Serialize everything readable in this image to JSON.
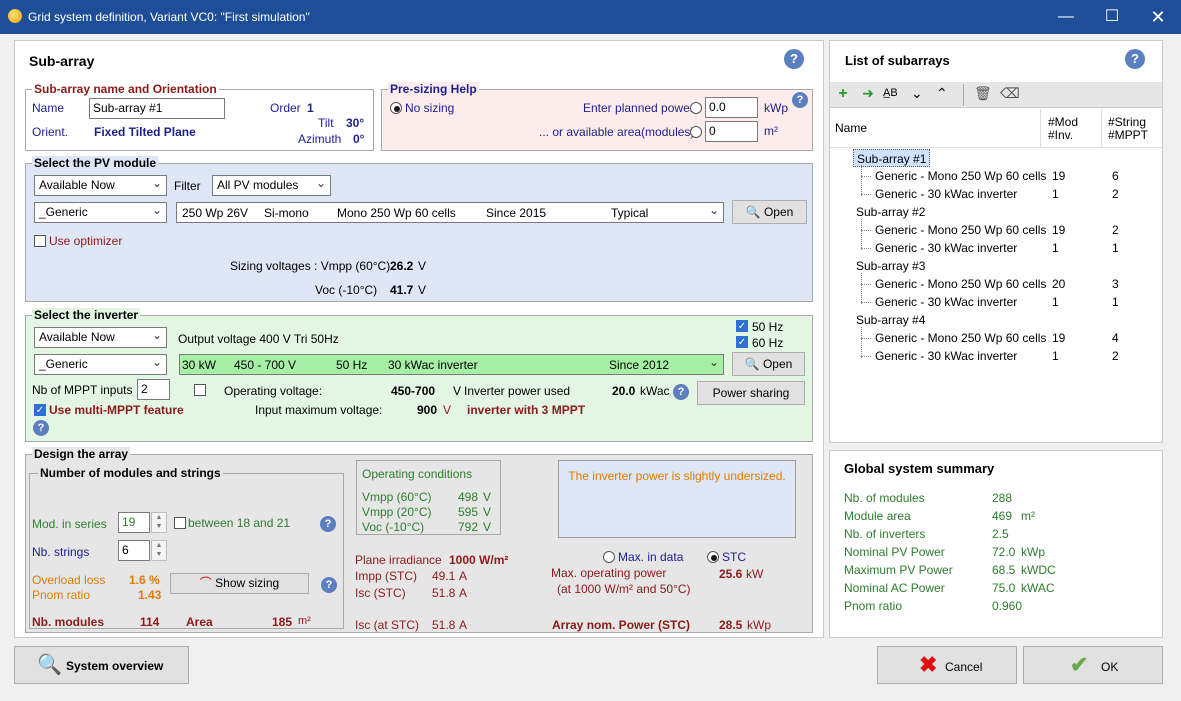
{
  "window": {
    "title": "Grid system definition, Variant VC0:   \"First simulation\""
  },
  "subarray_panel": {
    "title": "Sub-array",
    "name_orient": {
      "title": "Sub-array name and Orientation",
      "name_label": "Name",
      "name_value": "Sub-array #1",
      "order_label": "Order",
      "order_value": "1",
      "orient_label": "Orient.",
      "orient_value": "Fixed Tilted Plane",
      "tilt_label": "Tilt",
      "tilt_value": "30°",
      "azimuth_label": "Azimuth",
      "azimuth_value": "0°"
    },
    "presizing": {
      "title": "Pre-sizing Help",
      "no_sizing": "No sizing",
      "planned_power_label": "Enter planned power",
      "planned_power_value": "0.0",
      "planned_power_unit": "kWp",
      "area_label": "...  or available area(modules)",
      "area_value": "0",
      "area_unit": "m²"
    },
    "pv_module": {
      "title": "Select the PV module",
      "availability": "Available Now",
      "filter_label": "Filter",
      "filter_value": "All PV modules",
      "manufacturer": "_Generic",
      "model": [
        "250 Wp 26V",
        "Si-mono",
        "Mono 250 Wp  60 cells",
        "Since 2015",
        "Typical"
      ],
      "open": "Open",
      "optimizer": "Use optimizer",
      "sizing_voltages_label": "Sizing voltages :  Vmpp (60°C)",
      "vmpp_value": "26.2",
      "voc_label": "Voc (-10°C)",
      "voc_value": "41.7",
      "unit_v": "V"
    },
    "inverter": {
      "title": "Select the inverter",
      "availability": "Available Now",
      "output_voltage": "Output voltage 400 V Tri 50Hz",
      "hz50": "50 Hz",
      "hz60": "60 Hz",
      "manufacturer": "_Generic",
      "model": [
        "30 kW",
        "450 - 700 V",
        "50 Hz",
        "30 kWac inverter",
        "Since 2012"
      ],
      "open": "Open",
      "mppt_label": "Nb of MPPT inputs",
      "mppt_value": "2",
      "op_voltage_label": "Operating voltage:",
      "op_voltage_value": "450-700",
      "op_voltage_unit": "V",
      "power_used_label": "Inverter power used",
      "power_used_value": "20.0",
      "power_used_unit": "kWac",
      "power_sharing": "Power sharing",
      "multi_mppt": "Use multi-MPPT feature",
      "input_max_label": "Input maximum voltage:",
      "input_max_value": "900",
      "input_max_unit": "V",
      "mppt_info": "inverter with 3 MPPT"
    },
    "design": {
      "title": "Design the array",
      "nb_group_title": "Number of modules and strings",
      "mod_series_label": "Mod. in series",
      "mod_series_value": "19",
      "between": "between 18 and 21",
      "nb_strings_label": "Nb. strings",
      "nb_strings_value": "6",
      "overload_label": "Overload loss",
      "overload_value": "1.6 %",
      "pnom_label": "Pnom ratio",
      "pnom_value": "1.43",
      "show_sizing": "Show sizing",
      "nb_modules_label": "Nb. modules",
      "nb_modules_value": "114",
      "area_label": "Area",
      "area_value": "185",
      "area_unit": "m²",
      "opcond_title": "Operating conditions",
      "opcond": [
        {
          "label": "Vmpp (60°C)",
          "value": "498",
          "unit": "V"
        },
        {
          "label": "Vmpp (20°C)",
          "value": "595",
          "unit": "V"
        },
        {
          "label": "Voc (-10°C)",
          "value": "792",
          "unit": "V"
        }
      ],
      "warning": "The inverter power is slightly undersized.",
      "plane_irr_label": "Plane irradiance",
      "plane_irr_value": "1000 W/m²",
      "impp_label": "Impp (STC)",
      "impp_value": "49.1",
      "isc_label": "Isc (STC)",
      "isc_value": "51.8",
      "isc_at_label": "Isc (at STC)",
      "isc_at_value": "51.8",
      "unit_a": "A",
      "max_in_data": "Max. in data",
      "stc": "STC",
      "max_op_label": "Max. operating power",
      "max_op_sub": "(at 1000 W/m²  and 50°C)",
      "max_op_value": "25.6",
      "max_op_unit": "kW",
      "nom_power_label": "Array nom. Power (STC)",
      "nom_power_value": "28.5",
      "nom_power_unit": "kWp"
    }
  },
  "list_panel": {
    "title": "List of subarrays",
    "col_name": "Name",
    "col_mod_1": "#Mod",
    "col_mod_2": "#Inv.",
    "col_string_1": "#String",
    "col_string_2": "#MPPT",
    "subarrays": [
      {
        "name": "Sub-array #1",
        "module": "Generic - Mono 250 Wp  60 cells",
        "mod": "19",
        "str": "6",
        "inverter": "Generic - 30 kWac inverter",
        "inv": "1",
        "mppt": "2"
      },
      {
        "name": "Sub-array #2",
        "module": "Generic - Mono 250 Wp  60 cells",
        "mod": "19",
        "str": "2",
        "inverter": "Generic - 30 kWac inverter",
        "inv": "1",
        "mppt": "1"
      },
      {
        "name": "Sub-array #3",
        "module": "Generic - Mono 250 Wp  60 cells",
        "mod": "20",
        "str": "3",
        "inverter": "Generic - 30 kWac inverter",
        "inv": "1",
        "mppt": "1"
      },
      {
        "name": "Sub-array #4",
        "module": "Generic - Mono 250 Wp  60 cells",
        "mod": "19",
        "str": "4",
        "inverter": "Generic - 30 kWac inverter",
        "inv": "1",
        "mppt": "2"
      }
    ]
  },
  "summary": {
    "title": "Global system summary",
    "rows": [
      {
        "label": "Nb. of modules",
        "value": "288",
        "unit": ""
      },
      {
        "label": "Module area",
        "value": "469",
        "unit": "m²"
      },
      {
        "label": "Nb. of inverters",
        "value": "2.5",
        "unit": ""
      },
      {
        "label": "Nominal PV Power",
        "value": "72.0",
        "unit": "kWp"
      },
      {
        "label": "Maximum PV Power",
        "value": "68.5",
        "unit": "kWDC"
      },
      {
        "label": "Nominal AC Power",
        "value": "75.0",
        "unit": "kWAC"
      },
      {
        "label": "Pnom ratio",
        "value": "0.960",
        "unit": ""
      }
    ]
  },
  "footer": {
    "system_overview": "System overview",
    "cancel": "Cancel",
    "ok": "OK"
  }
}
